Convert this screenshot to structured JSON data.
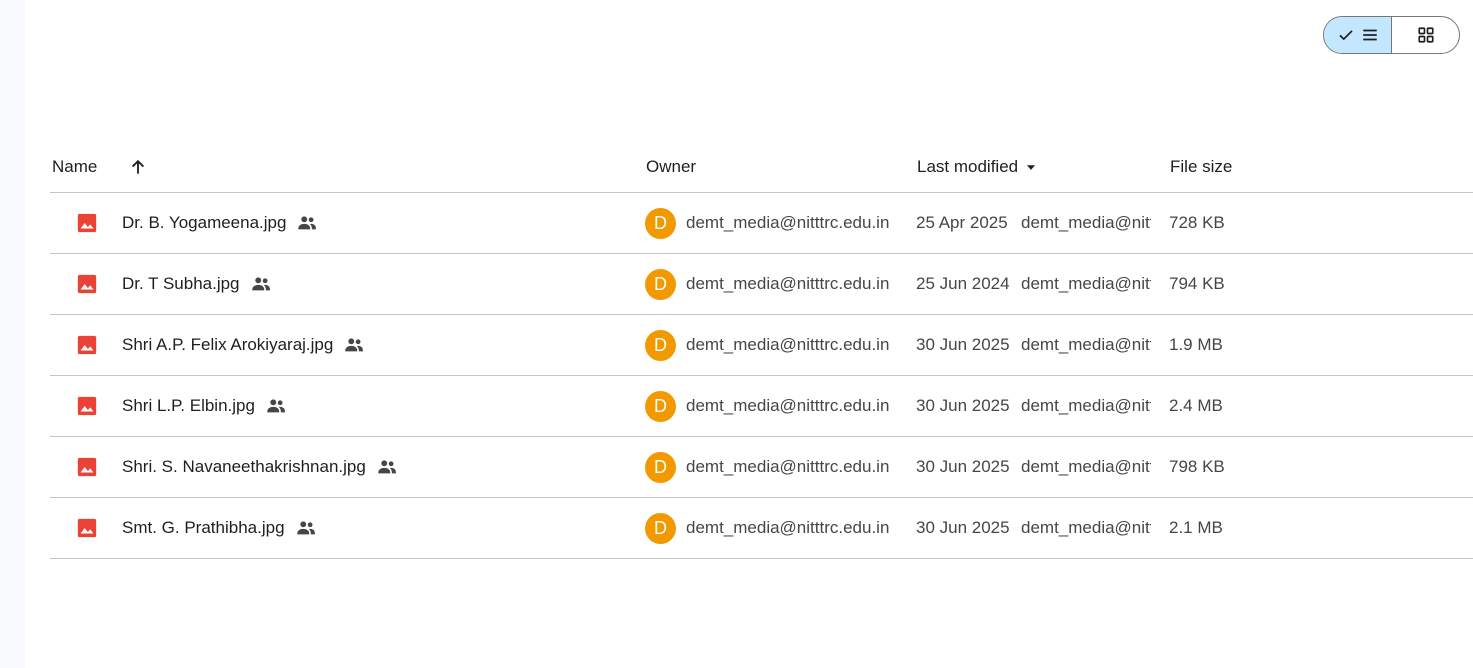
{
  "view_toggle": {
    "list_icon": "check-list-icon",
    "grid_icon": "grid-icon"
  },
  "header": {
    "name": "Name",
    "sort_icon": "arrow-up-icon",
    "owner": "Owner",
    "last_modified": "Last modified",
    "last_modified_icon": "caret-down-icon",
    "file_size": "File size"
  },
  "files": [
    {
      "name": "Dr. B. Yogameena.jpg",
      "avatar": "D",
      "owner": "demt_media@nitttrc.edu.in",
      "date": "25 Apr 2025",
      "modified_by": "demt_media@nitttrc.edu.in",
      "size": "728 KB"
    },
    {
      "name": "Dr. T Subha.jpg",
      "avatar": "D",
      "owner": "demt_media@nitttrc.edu.in",
      "date": "25 Jun 2024",
      "modified_by": "demt_media@nitttrc.edu.in",
      "size": "794 KB"
    },
    {
      "name": "Shri A.P. Felix Arokiyaraj.jpg",
      "avatar": "D",
      "owner": "demt_media@nitttrc.edu.in",
      "date": "30 Jun 2025",
      "modified_by": "demt_media@nitttrc.edu.in",
      "size": "1.9 MB"
    },
    {
      "name": "Shri L.P. Elbin.jpg",
      "avatar": "D",
      "owner": "demt_media@nitttrc.edu.in",
      "date": "30 Jun 2025",
      "modified_by": "demt_media@nitttrc.edu.in",
      "size": "2.4 MB"
    },
    {
      "name": "Shri. S. Navaneethakrishnan.jpg",
      "avatar": "D",
      "owner": "demt_media@nitttrc.edu.in",
      "date": "30 Jun 2025",
      "modified_by": "demt_media@nitttrc.edu.in",
      "size": "798 KB"
    },
    {
      "name": "Smt. G. Prathibha.jpg",
      "avatar": "D",
      "owner": "demt_media@nitttrc.edu.in",
      "date": "30 Jun 2025",
      "modified_by": "demt_media@nitttrc.edu.in",
      "size": "2.1 MB"
    }
  ],
  "colors": {
    "image_icon": "#ea4335",
    "avatar_bg": "#f29900",
    "toggle_active_bg": "#c2e7ff"
  }
}
